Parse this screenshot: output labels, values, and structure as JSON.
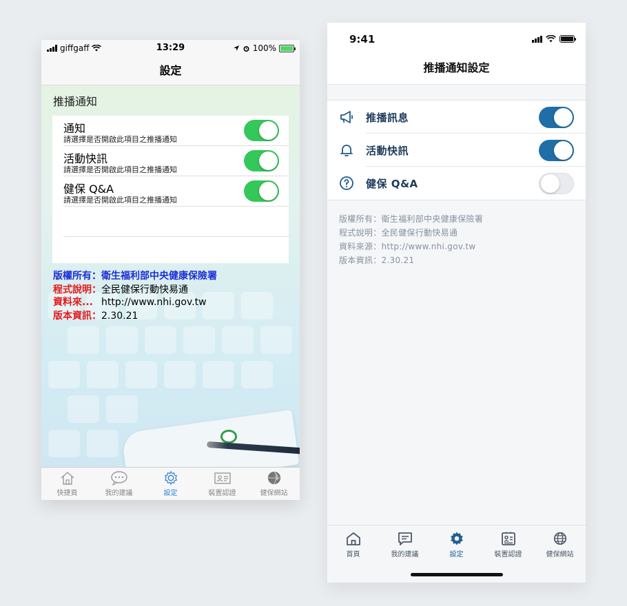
{
  "old": {
    "status": {
      "carrier": "giffgaff",
      "time": "13:29",
      "battery": "100%"
    },
    "title": "設定",
    "section_title": "推播通知",
    "rows": [
      {
        "title": "通知",
        "subtitle": "請選擇是否開啟此項目之推播通知",
        "on": true
      },
      {
        "title": "活動快訊",
        "subtitle": "請選擇是否開啟此項目之推播通知",
        "on": true
      },
      {
        "title": "健保 Q&A",
        "subtitle": "請選擇是否開啟此項目之推播通知",
        "on": true
      }
    ],
    "info": {
      "copyright_key": "版權所有：",
      "copyright_val": "衛生福利部中央健康保險署",
      "desc_key": "程式說明：",
      "desc_val": "全民健保行動快易通",
      "source_key": "資料來...",
      "source_val": "http://www.nhi.gov.tw",
      "version_key": "版本資訊：",
      "version_val": "2.30.21"
    },
    "tabs": [
      {
        "label": "快捷頁",
        "icon": "home-icon"
      },
      {
        "label": "我的建議",
        "icon": "chat-icon"
      },
      {
        "label": "設定",
        "icon": "gear-icon",
        "active": true
      },
      {
        "label": "裝置認證",
        "icon": "id-card-icon"
      },
      {
        "label": "健保網站",
        "icon": "globe-icon"
      }
    ]
  },
  "new": {
    "status": {
      "time": "9:41"
    },
    "title": "推播通知設定",
    "rows": [
      {
        "label": "推播訊息",
        "icon": "megaphone-icon",
        "on": true
      },
      {
        "label": "活動快訊",
        "icon": "bell-icon",
        "on": true
      },
      {
        "label": "健保 Q&A",
        "icon": "question-icon",
        "on": false
      }
    ],
    "info": [
      "版權所有：衛生福利部中央健康保險署",
      "程式說明：全民健保行動快易通",
      "資料來源：http://www.nhi.gov.tw",
      "版本資訊：2.30.21"
    ],
    "tabs": [
      {
        "label": "首頁",
        "icon": "home-icon"
      },
      {
        "label": "我的建議",
        "icon": "message-icon"
      },
      {
        "label": "設定",
        "icon": "gear-icon",
        "active": true
      },
      {
        "label": "裝置認證",
        "icon": "id-card-icon"
      },
      {
        "label": "健保網站",
        "icon": "globe-icon"
      }
    ]
  },
  "colors": {
    "old_toggle_on": "#34c759",
    "new_toggle_on": "#1f6ea8",
    "new_active_tab": "#1f5f93",
    "old_active_tab": "#2f7fd6"
  }
}
